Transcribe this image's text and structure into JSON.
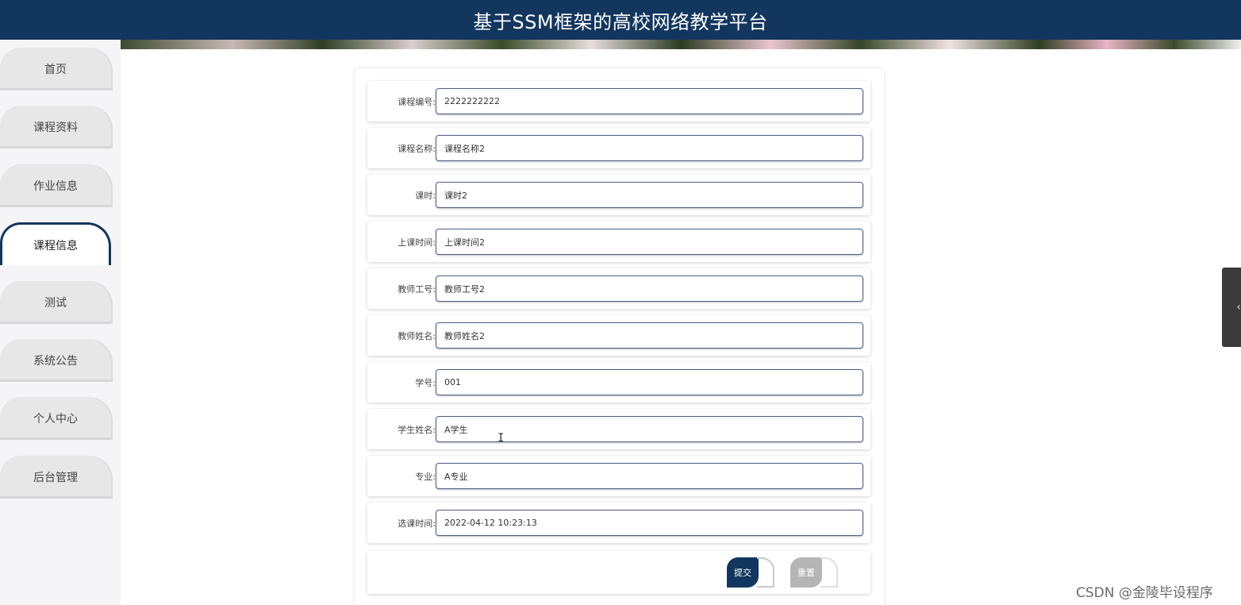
{
  "header": {
    "title": "基于SSM框架的高校网络教学平台"
  },
  "sidebar": {
    "items": [
      {
        "label": "首页"
      },
      {
        "label": "课程资料"
      },
      {
        "label": "作业信息"
      },
      {
        "label": "课程信息",
        "active": true
      },
      {
        "label": "测试"
      },
      {
        "label": "系统公告"
      },
      {
        "label": "个人中心"
      },
      {
        "label": "后台管理"
      }
    ]
  },
  "form": {
    "fields": [
      {
        "label": "课程编号:",
        "value": "2222222222"
      },
      {
        "label": "课程名称:",
        "value": "课程名称2"
      },
      {
        "label": "课时:",
        "value": "课时2"
      },
      {
        "label": "上课时间:",
        "value": "上课时间2"
      },
      {
        "label": "教师工号:",
        "value": "教师工号2"
      },
      {
        "label": "教师姓名:",
        "value": "教师姓名2"
      },
      {
        "label": "学号:",
        "value": "001"
      },
      {
        "label": "学生姓名:",
        "value": "A学生"
      },
      {
        "label": "专业:",
        "value": "A专业"
      },
      {
        "label": "选课时间:",
        "value": "2022-04-12 10:23:13"
      }
    ],
    "submit_label": "提交",
    "reset_label": "重置"
  },
  "side_tab": {
    "icon": "chevron-left-icon",
    "glyph": "‹"
  },
  "watermark": "CSDN @金陵毕设程序",
  "colors": {
    "brand": "#12365e"
  }
}
